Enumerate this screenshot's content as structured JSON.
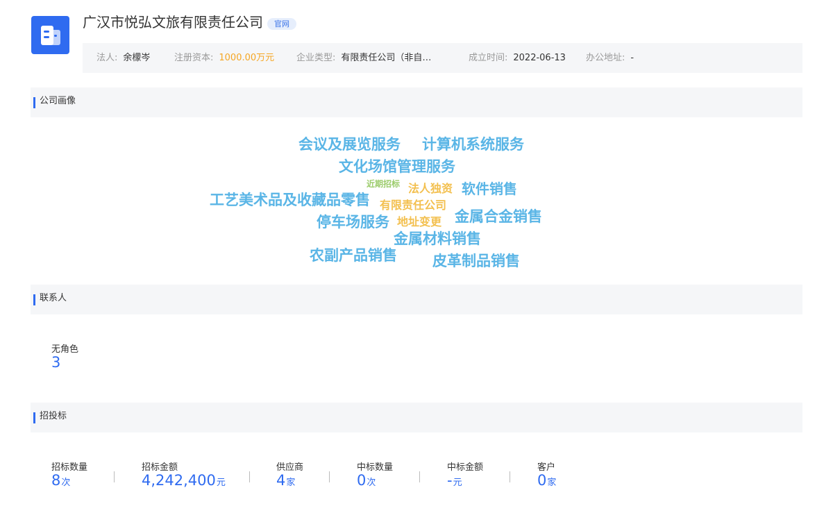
{
  "company": {
    "name": "广汉市悦弘文旅有限责任公司",
    "official_tag": "官网",
    "logo_icon": "company-building-icon"
  },
  "info": {
    "legal_label": "法人:",
    "legal_value": "余檬岑",
    "capital_label": "注册资本:",
    "capital_value": "1000.00万元",
    "type_label": "企业类型:",
    "type_value": "有限责任公司（非自…",
    "founded_label": "成立时间:",
    "founded_value": "2022-06-13",
    "address_label": "办公地址:",
    "address_value": "-"
  },
  "sections": {
    "profile": "公司画像",
    "contacts": "联系人",
    "bidding": "招投标"
  },
  "tags": [
    "会议及展览服务",
    "计算机系统服务",
    "文化场馆管理服务",
    "近期招标",
    "法人独资",
    "软件销售",
    "工艺美术品及收藏品零售",
    "有限责任公司",
    "停车场服务",
    "地址变更",
    "金属合金销售",
    "金属材料销售",
    "农副产品销售",
    "皮革制品销售"
  ],
  "contacts": {
    "label": "无角色",
    "count": "3"
  },
  "bidding_stats": [
    {
      "label": "招标数量",
      "value": "8",
      "unit": "次"
    },
    {
      "label": "招标金额",
      "value": "4,242,400",
      "unit": "元"
    },
    {
      "label": "供应商",
      "value": "4",
      "unit": "家"
    },
    {
      "label": "中标数量",
      "value": "0",
      "unit": "次"
    },
    {
      "label": "中标金额",
      "value": "-",
      "unit": "元"
    },
    {
      "label": "客户",
      "value": "0",
      "unit": "家"
    }
  ],
  "colors": {
    "accent": "#2f6bf0",
    "tag_blue": "#5ab5e6",
    "tag_orange": "#f3c050",
    "tag_green": "#9ccc6c",
    "capital": "#f5a623"
  }
}
